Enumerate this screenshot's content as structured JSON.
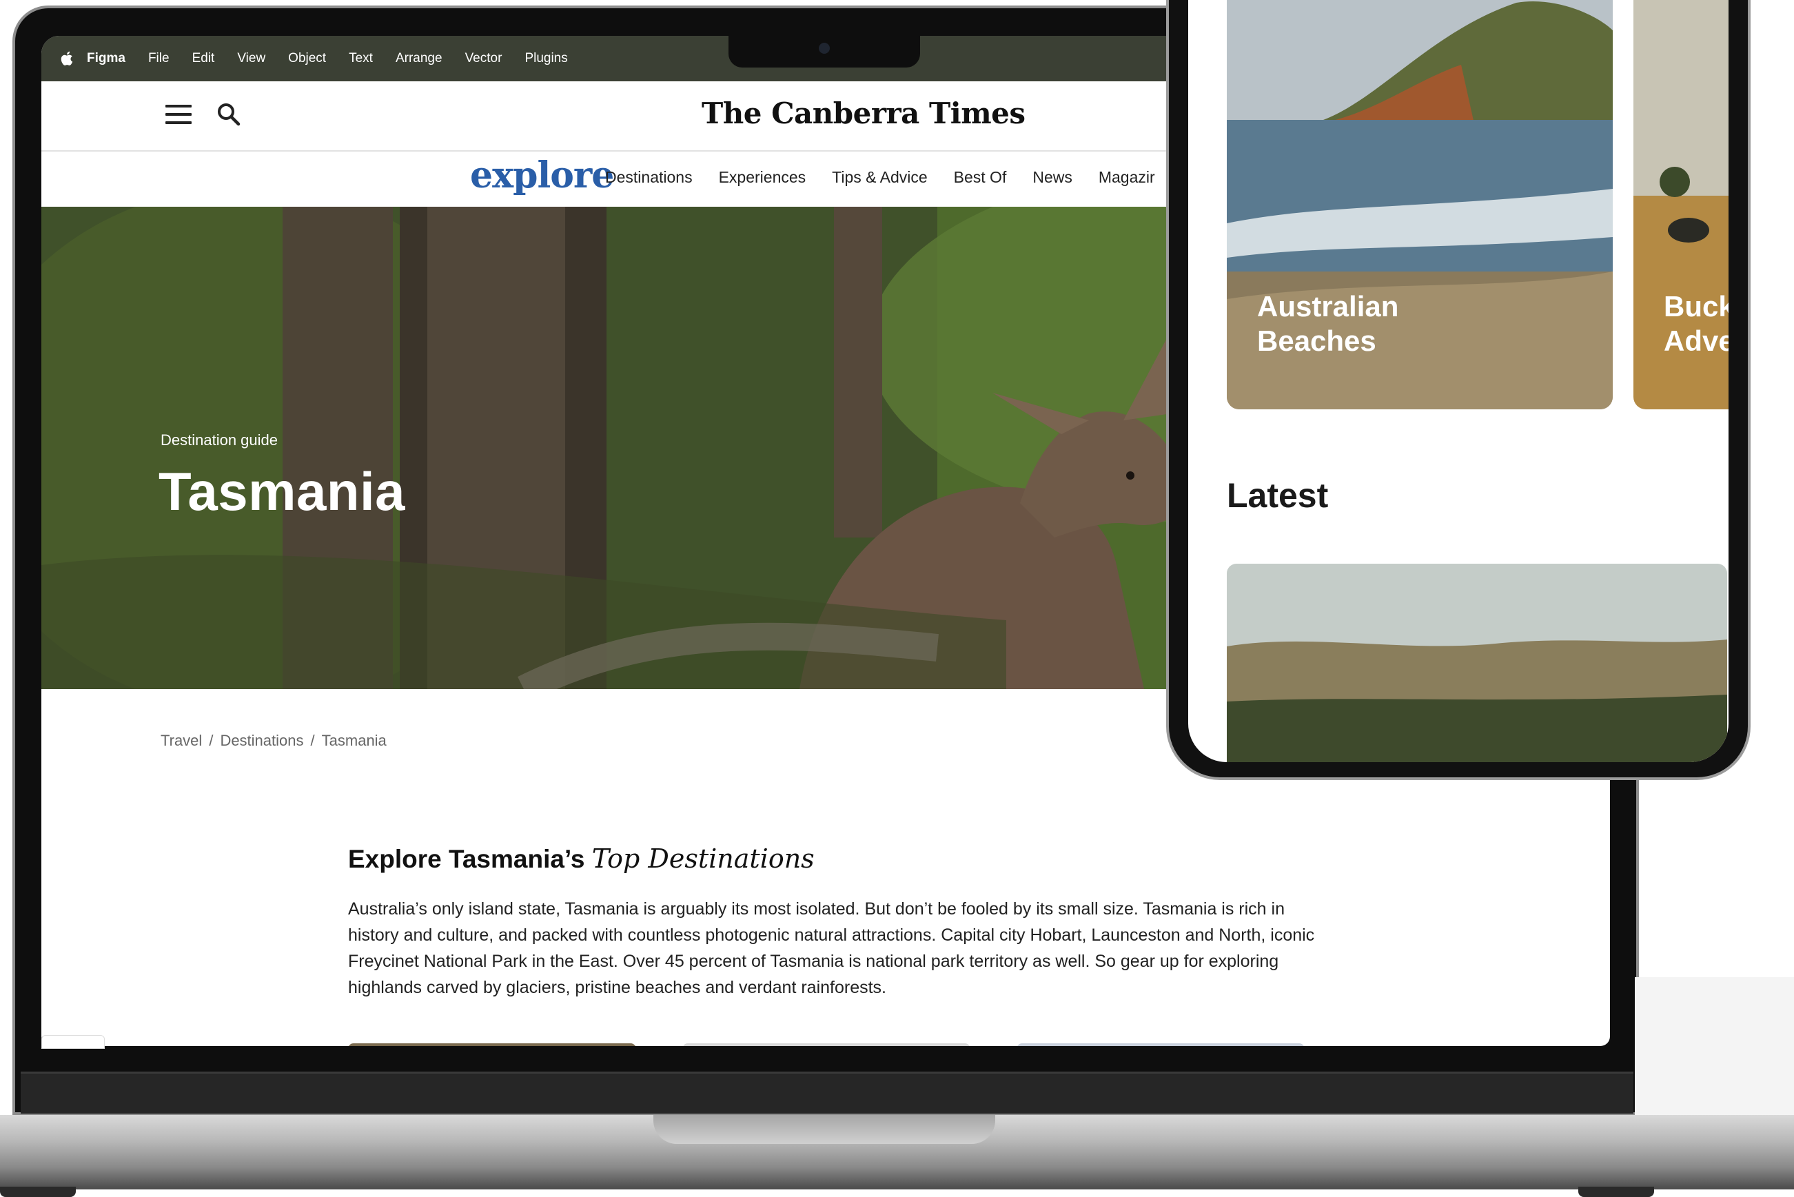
{
  "menubar": {
    "app_name": "Figma",
    "items": [
      "File",
      "Edit",
      "View",
      "Object",
      "Text",
      "Arrange",
      "Vector",
      "Plugins"
    ]
  },
  "site": {
    "masthead": "The Canberra Times",
    "section_logo": "explore",
    "nav": [
      "Destinations",
      "Experiences",
      "Tips & Advice",
      "Best Of",
      "News",
      "Magazir"
    ]
  },
  "hero": {
    "kicker": "Destination guide",
    "title": "Tasmania"
  },
  "breadcrumb": [
    "Travel",
    "Destinations",
    "Tasmania"
  ],
  "article": {
    "heading_plain": "Explore Tasmania’s",
    "heading_italic": "Top Destinations",
    "body": "Australia’s only island state, Tasmania is arguably its most isolated. But don’t be fooled by its small size. Tasmania is rich in history and culture, and packed with countless photogenic natural attractions. Capital city Hobart, Launceston and North, iconic Freycinet National Park in the East. Over 45 percent of Tasmania is national park territory as well. So gear up for exploring highlands carved by glaciers, pristine beaches and verdant rainforests."
  },
  "phone": {
    "cards": [
      {
        "line1": "Australian",
        "line2": "Beaches"
      },
      {
        "line1": "Bucket-list",
        "line2": "Adventure"
      }
    ],
    "latest_title": "Latest"
  },
  "colors": {
    "menubar_bg": "#3b4034",
    "explore_blue": "#2a5ea8"
  }
}
